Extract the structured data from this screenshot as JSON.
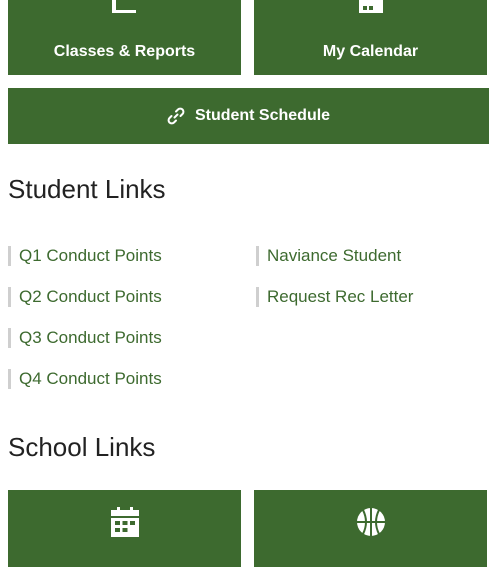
{
  "top_tiles": [
    {
      "label": "Classes & Reports",
      "icon": "report-icon"
    },
    {
      "label": "My Calendar",
      "icon": "calendar-icon"
    }
  ],
  "schedule_bar": {
    "label": "Student Schedule",
    "icon": "link-icon"
  },
  "student_links": {
    "heading": "Student Links",
    "column1": [
      "Q1 Conduct Points",
      "Q2 Conduct Points",
      "Q3 Conduct Points",
      "Q4 Conduct Points"
    ],
    "column2": [
      "Naviance Student",
      "Request Rec Letter"
    ]
  },
  "school_links": {
    "heading": "School Links",
    "tiles": [
      {
        "icon": "calendar-icon"
      },
      {
        "icon": "basketball-icon"
      }
    ]
  },
  "colors": {
    "accent": "#3d6a2f",
    "link": "#3d6a2f",
    "heading": "#222222"
  }
}
